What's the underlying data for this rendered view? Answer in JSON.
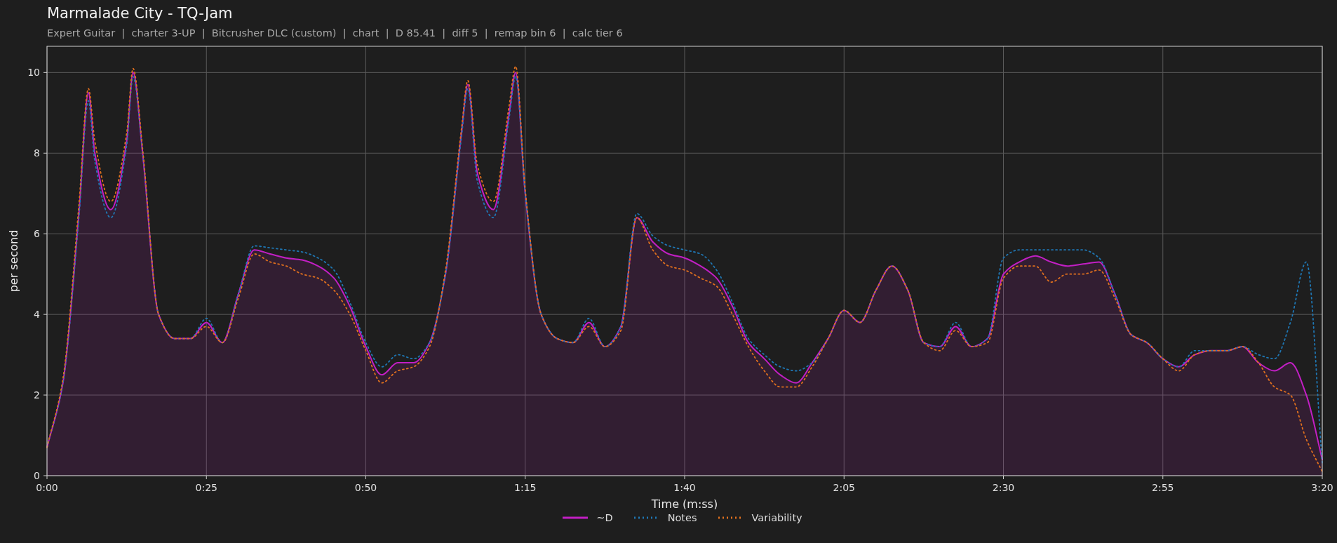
{
  "title": "Marmalade City - TQ-Jam",
  "subtitle": "Expert Guitar  |  charter 3-UP  |  Bitcrusher DLC (custom)  |  chart  |  D 85.41  |  diff 5  |  remap bin 6  |  calc tier 6",
  "chart_data": {
    "type": "line",
    "grid": true,
    "xlabel": "Time (m:ss)",
    "ylabel": "per second",
    "xlim": [
      0,
      200
    ],
    "ylim": [
      0,
      10.65
    ],
    "xticks": [
      {
        "value": 0,
        "label": "0:00"
      },
      {
        "value": 25,
        "label": "0:25"
      },
      {
        "value": 50,
        "label": "0:50"
      },
      {
        "value": 75,
        "label": "1:15"
      },
      {
        "value": 100,
        "label": "1:40"
      },
      {
        "value": 125,
        "label": "2:05"
      },
      {
        "value": 150,
        "label": "2:30"
      },
      {
        "value": 175,
        "label": "2:55"
      },
      {
        "value": 200,
        "label": "3:20"
      }
    ],
    "yticks": [
      0,
      2,
      4,
      6,
      8,
      10
    ],
    "x": [
      0,
      2.5,
      5,
      6.5,
      7.5,
      10,
      12.5,
      13.5,
      15,
      17.5,
      20,
      22.5,
      25,
      27.5,
      30,
      32.5,
      35,
      37.5,
      40,
      42.5,
      45,
      47.5,
      50,
      52.5,
      55,
      57.5,
      60,
      62.5,
      65,
      66,
      67.5,
      70,
      72.5,
      73.5,
      75,
      77.5,
      80,
      82.5,
      85,
      87.5,
      90,
      92.5,
      95,
      97.5,
      100,
      102.5,
      105,
      107.5,
      110,
      112.5,
      115,
      117.5,
      120,
      122.5,
      125,
      127.5,
      130,
      132.5,
      135,
      137.5,
      140,
      142.5,
      145,
      147.5,
      150,
      152.5,
      155,
      157.5,
      160,
      162.5,
      165,
      167.5,
      170,
      172.5,
      175,
      177.5,
      180,
      182.5,
      185,
      187.5,
      190,
      192.5,
      195,
      197.5,
      200
    ],
    "series": [
      {
        "name": "~D",
        "type": "area",
        "color": "#c21fc4",
        "line_style": "solid",
        "values": [
          0.7,
          2.3,
          6.5,
          9.5,
          8.0,
          6.6,
          8.3,
          10.0,
          8.0,
          4.0,
          3.4,
          3.4,
          3.8,
          3.3,
          4.5,
          5.6,
          5.5,
          5.4,
          5.35,
          5.2,
          4.9,
          4.2,
          3.2,
          2.5,
          2.8,
          2.8,
          3.3,
          5.0,
          8.5,
          9.7,
          7.5,
          6.6,
          9.0,
          10.0,
          7.0,
          4.0,
          3.4,
          3.3,
          3.8,
          3.2,
          3.7,
          6.4,
          5.8,
          5.5,
          5.4,
          5.2,
          4.9,
          4.2,
          3.3,
          2.9,
          2.5,
          2.3,
          2.8,
          3.4,
          4.1,
          3.8,
          4.6,
          5.2,
          4.6,
          3.3,
          3.2,
          3.7,
          3.2,
          3.4,
          5.0,
          5.3,
          5.45,
          5.3,
          5.2,
          5.25,
          5.3,
          4.5,
          3.5,
          3.3,
          2.9,
          2.7,
          3.0,
          3.1,
          3.1,
          3.2,
          2.8,
          2.6,
          2.8,
          2.0,
          0.4
        ]
      },
      {
        "name": "Notes",
        "type": "line",
        "color": "#1f77b4",
        "line_style": "dotted",
        "values": [
          0.7,
          2.3,
          6.4,
          9.3,
          7.8,
          6.4,
          8.2,
          9.9,
          8.0,
          4.0,
          3.4,
          3.4,
          3.9,
          3.3,
          4.5,
          5.7,
          5.65,
          5.6,
          5.55,
          5.4,
          5.1,
          4.3,
          3.3,
          2.7,
          3.0,
          2.9,
          3.3,
          5.0,
          8.4,
          9.6,
          7.3,
          6.4,
          8.9,
          9.9,
          7.0,
          4.0,
          3.4,
          3.3,
          3.9,
          3.2,
          3.7,
          6.5,
          5.95,
          5.7,
          5.6,
          5.5,
          5.1,
          4.3,
          3.4,
          3.0,
          2.7,
          2.6,
          2.8,
          3.4,
          4.1,
          3.8,
          4.6,
          5.2,
          4.6,
          3.3,
          3.2,
          3.8,
          3.2,
          3.4,
          5.4,
          5.6,
          5.6,
          5.6,
          5.6,
          5.6,
          5.4,
          4.5,
          3.5,
          3.3,
          2.9,
          2.7,
          3.1,
          3.1,
          3.1,
          3.2,
          3.0,
          2.9,
          3.8,
          5.3,
          0.3
        ]
      },
      {
        "name": "Variability",
        "type": "line",
        "color": "#e0701e",
        "line_style": "dotted",
        "values": [
          0.7,
          2.4,
          6.7,
          9.6,
          8.3,
          6.8,
          8.5,
          10.1,
          8.1,
          4.0,
          3.4,
          3.4,
          3.7,
          3.3,
          4.4,
          5.5,
          5.3,
          5.2,
          5.0,
          4.9,
          4.6,
          4.0,
          3.1,
          2.3,
          2.6,
          2.7,
          3.2,
          5.1,
          8.6,
          9.8,
          7.7,
          6.8,
          9.2,
          10.15,
          7.1,
          4.0,
          3.4,
          3.3,
          3.7,
          3.2,
          3.6,
          6.4,
          5.6,
          5.2,
          5.1,
          4.9,
          4.7,
          4.0,
          3.2,
          2.6,
          2.2,
          2.2,
          2.7,
          3.4,
          4.1,
          3.8,
          4.6,
          5.2,
          4.6,
          3.3,
          3.1,
          3.6,
          3.2,
          3.3,
          4.9,
          5.2,
          5.2,
          4.8,
          5.0,
          5.0,
          5.1,
          4.4,
          3.5,
          3.3,
          2.9,
          2.6,
          3.0,
          3.1,
          3.1,
          3.2,
          2.8,
          2.2,
          2.0,
          0.9,
          0.1
        ]
      }
    ]
  }
}
